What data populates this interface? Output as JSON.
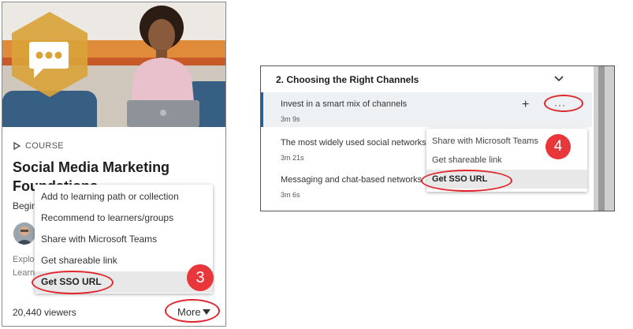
{
  "left_card": {
    "kind_label": "COURSE",
    "title": "Social Media Marketing Foundations",
    "level": "Begin",
    "description_fragment": "Explo Learn",
    "viewers": "20,440 viewers",
    "more_label": "More"
  },
  "left_menu": {
    "items": [
      {
        "label": "Add to learning path or collection"
      },
      {
        "label": "Recommend to learners/groups"
      },
      {
        "label": "Share with Microsoft Teams"
      },
      {
        "label": "Get shareable link"
      },
      {
        "label": "Get SSO URL"
      }
    ],
    "step_badge": "3"
  },
  "right_panel": {
    "section_title": "2. Choosing the Right Channels",
    "lessons": [
      {
        "title": "Invest in a smart mix of channels",
        "duration": "3m 9s"
      },
      {
        "title": "The most widely used social networks",
        "duration": "3m 21s"
      },
      {
        "title": "Messaging and chat-based networks",
        "duration": "3m 6s"
      }
    ],
    "plus_label": "+",
    "dots_label": "···"
  },
  "right_menu": {
    "items": [
      {
        "label": "Share with Microsoft Teams"
      },
      {
        "label": "Get shareable link"
      },
      {
        "label": "Get SSO URL"
      }
    ],
    "step_badge": "4"
  },
  "colors": {
    "highlight_ring": "#e0262c",
    "step_badge": "#e8363a",
    "active_lesson_bar": "#0a66c2",
    "hero_hexagon": "#d9a33a"
  },
  "icons": [
    "play-triangle-icon",
    "chevron-down-icon",
    "plus-icon",
    "ellipsis-icon",
    "caret-down-icon",
    "chat-bubble-icon"
  ]
}
